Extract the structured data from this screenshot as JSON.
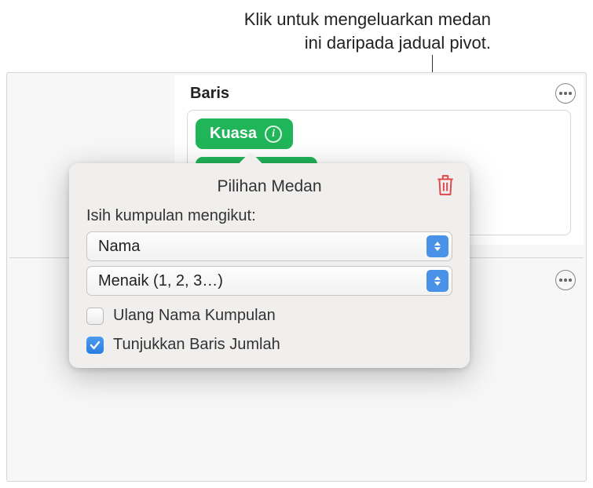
{
  "callout": {
    "line1": "Klik untuk mengeluarkan medan",
    "line2": "ini daripada jadual pivot."
  },
  "section": {
    "title": "Baris",
    "field_label": "Kuasa"
  },
  "popover": {
    "title": "Pilihan Medan",
    "sort_label": "Isih kumpulan mengikut:",
    "select1": "Nama",
    "select2": "Menaik (1, 2, 3…)",
    "checkbox1": "Ulang Nama Kumpulan",
    "checkbox2": "Tunjukkan Baris Jumlah"
  }
}
